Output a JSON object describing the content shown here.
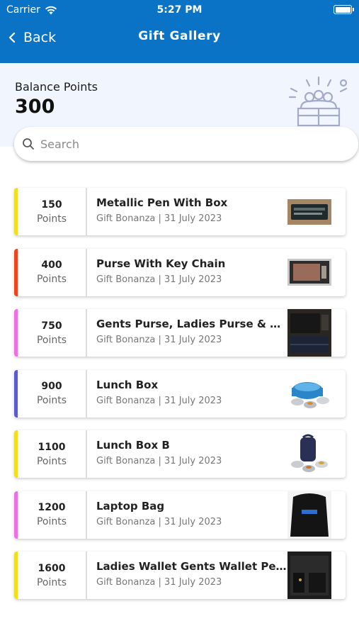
{
  "status_bar": {
    "carrier": "Carrier",
    "time": "5:27 PM"
  },
  "nav": {
    "back_label": "Back",
    "title": "Gift Gallery"
  },
  "balance": {
    "label": "Balance Points",
    "value": "300"
  },
  "search": {
    "placeholder": "Search"
  },
  "gifts": [
    {
      "points": "150",
      "unit": "Points",
      "name": "Metallic Pen With Box",
      "meta": "Gift Bonanza | 31 July 2023",
      "accent": "#f2df19",
      "icon": "pen-box-thumbnail"
    },
    {
      "points": "400",
      "unit": "Points",
      "name": "Purse With Key Chain",
      "meta": "Gift Bonanza | 31 July 2023",
      "accent": "#f1431c",
      "icon": "purse-thumbnail"
    },
    {
      "points": "750",
      "unit": "Points",
      "name": "Gents Purse, Ladies Purse & Key ...",
      "meta": "Gift Bonanza | 31 July 2023",
      "accent": "#f26ce4",
      "icon": "purse-set-thumbnail"
    },
    {
      "points": "900",
      "unit": "Points",
      "name": "Lunch Box",
      "meta": "Gift Bonanza | 31 July 2023",
      "accent": "#5b5bd0",
      "icon": "lunch-box-thumbnail"
    },
    {
      "points": "1100",
      "unit": "Points",
      "name": "Lunch Box B",
      "meta": "Gift Bonanza | 31 July 2023",
      "accent": "#f2df19",
      "icon": "lunch-box-b-thumbnail"
    },
    {
      "points": "1200",
      "unit": "Points",
      "name": "Laptop Bag",
      "meta": "Gift Bonanza | 31 July 2023",
      "accent": "#f26ce4",
      "icon": "laptop-bag-thumbnail"
    },
    {
      "points": "1600",
      "unit": "Points",
      "name": "Ladies Wallet Gents Wallet Pen ...",
      "meta": "Gift Bonanza | 31 July 2023",
      "accent": "#f2df19",
      "icon": "wallet-set-thumbnail"
    }
  ],
  "colors": {
    "header": "#0a73c6",
    "balance_bg": "#f1f5fd"
  }
}
